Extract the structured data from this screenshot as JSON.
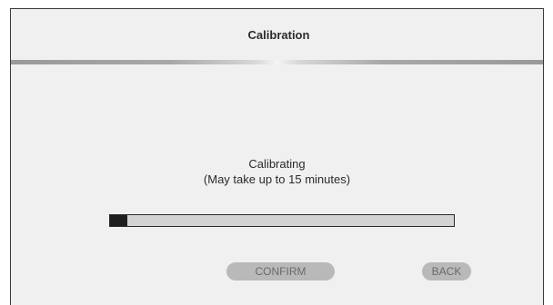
{
  "header": {
    "title": "Calibration"
  },
  "status": {
    "line1": "Calibrating",
    "line2": "(May take up to 15 minutes)"
  },
  "progress": {
    "fraction": 0.05
  },
  "buttons": {
    "confirm_label": "CONFIRM",
    "back_label": "BACK"
  },
  "colors": {
    "panel_background": "#f0f0f0",
    "progress_fill": "#1e1e1e",
    "progress_track": "#d3d3d3",
    "button_background": "#b9b9b9",
    "button_text": "#6a6a6a"
  }
}
